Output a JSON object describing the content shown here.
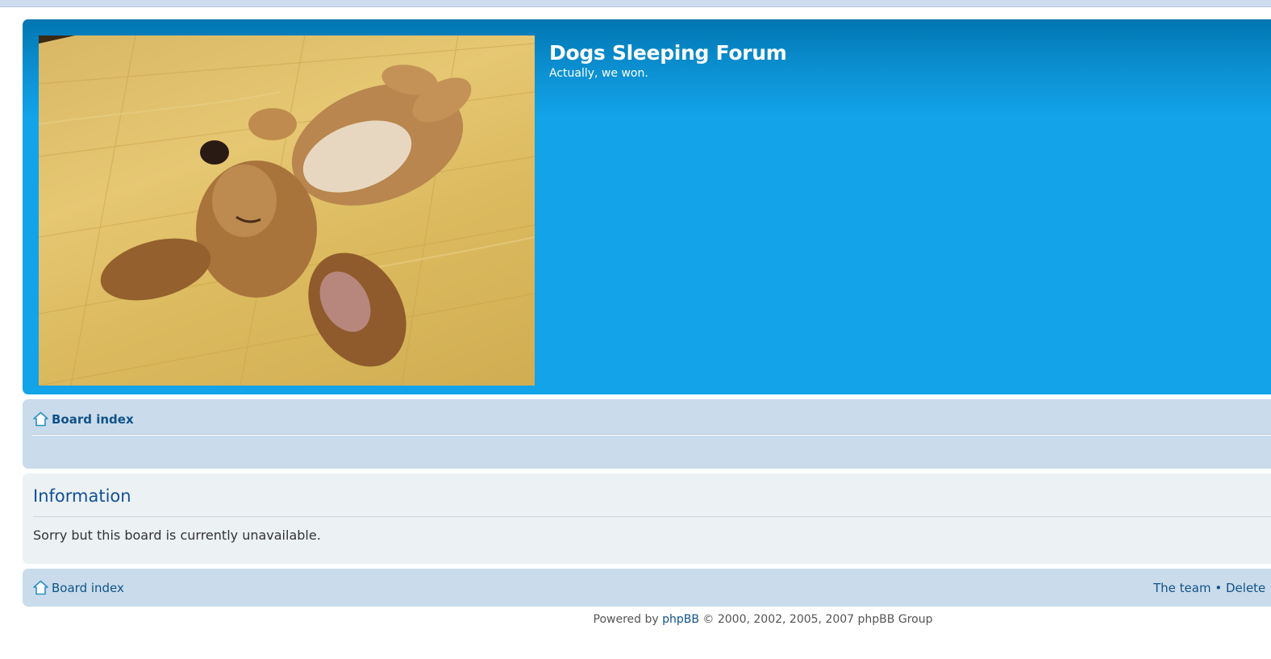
{
  "site": {
    "title": "Dogs Sleeping Forum",
    "description": "Actually, we won."
  },
  "logo": {
    "icon": "sleeping-puppy-photo"
  },
  "navbar": {
    "home_icon": "home-icon",
    "breadcrumb": "Board index"
  },
  "message": {
    "heading": "Information",
    "text": "Sorry but this board is currently unavailable."
  },
  "footer_nav": {
    "home_icon": "home-icon",
    "breadcrumb": "Board index",
    "team_link": "The team",
    "separator": "•",
    "delete_link": "Delete"
  },
  "copyright": {
    "prefix": "Powered by ",
    "link": "phpBB",
    "suffix": " © 2000, 2002, 2005, 2007 phpBB Group"
  },
  "colors": {
    "header_blue": "#12a3e8",
    "nav_bg": "#cadceb",
    "panel_bg": "#ecf1f3",
    "link": "#105289"
  }
}
